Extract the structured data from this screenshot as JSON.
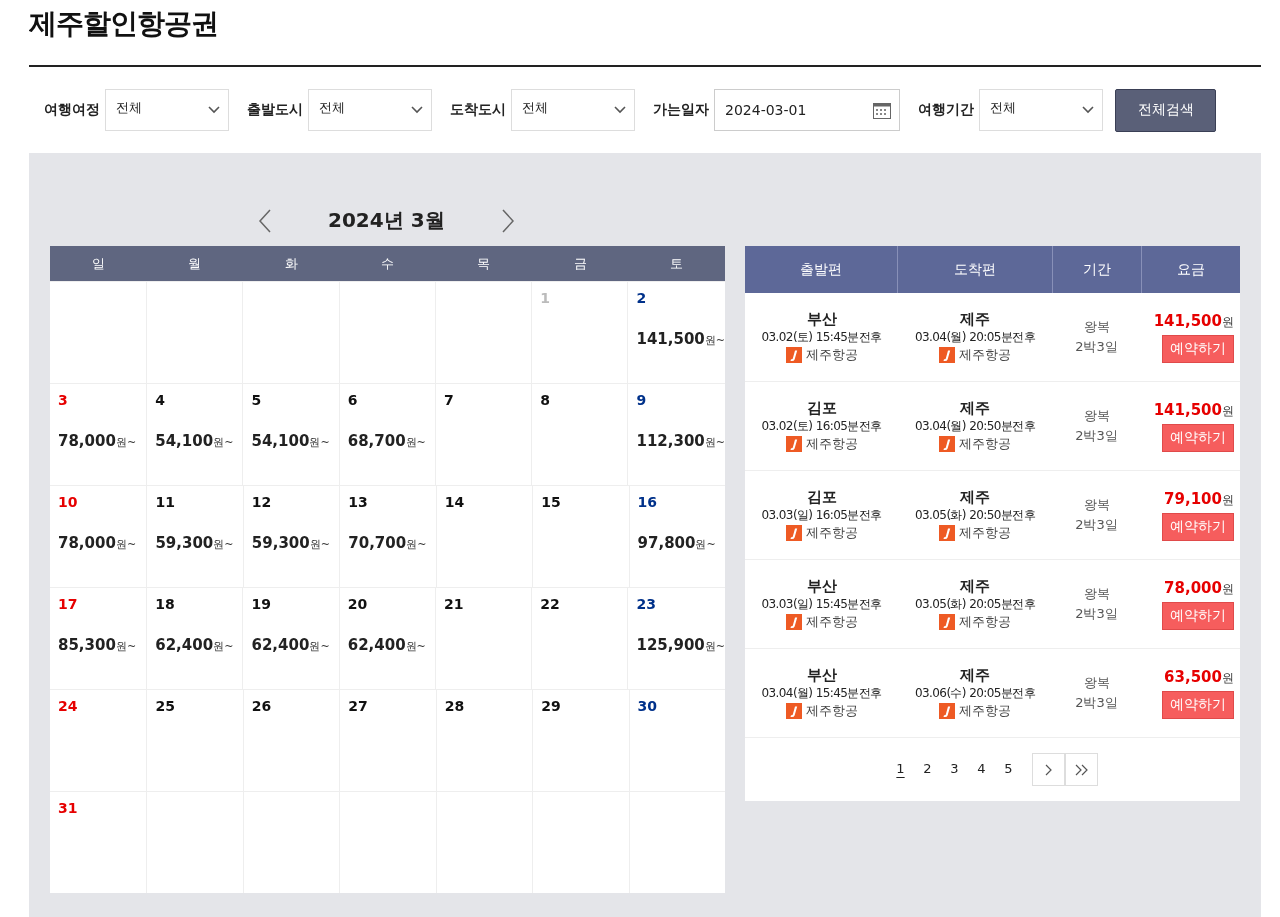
{
  "title": "제주할인항공권",
  "filters": [
    {
      "kind": "select",
      "label": "여행여정",
      "value": "전체"
    },
    {
      "kind": "select",
      "label": "출발도시",
      "value": "전체"
    },
    {
      "kind": "select",
      "label": "도착도시",
      "value": "전체"
    },
    {
      "kind": "date",
      "label": "가는일자",
      "value": "2024-03-01"
    },
    {
      "kind": "select",
      "label": "여행기간",
      "value": "전체"
    }
  ],
  "search_button": "전체검색",
  "calendar": {
    "month": "2024년 3월",
    "weekdays": [
      "일",
      "월",
      "화",
      "수",
      "목",
      "금",
      "토"
    ],
    "weeks": [
      [
        {
          "kind": "blank"
        },
        {
          "kind": "blank"
        },
        {
          "kind": "blank"
        },
        {
          "kind": "blank"
        },
        {
          "kind": "blank"
        },
        {
          "kind": "day",
          "day": "1",
          "disabled": true
        },
        {
          "kind": "day",
          "day": "2",
          "disabled": false,
          "price": "141,500",
          "unit": "원~"
        }
      ],
      [
        {
          "kind": "day",
          "day": "3",
          "disabled": false,
          "price": "78,000",
          "unit": "원~"
        },
        {
          "kind": "day",
          "day": "4",
          "disabled": false,
          "price": "54,100",
          "unit": "원~"
        },
        {
          "kind": "day",
          "day": "5",
          "disabled": false,
          "price": "54,100",
          "unit": "원~"
        },
        {
          "kind": "day",
          "day": "6",
          "disabled": false,
          "price": "68,700",
          "unit": "원~"
        },
        {
          "kind": "day",
          "day": "7",
          "disabled": false
        },
        {
          "kind": "day",
          "day": "8",
          "disabled": false
        },
        {
          "kind": "day",
          "day": "9",
          "disabled": false,
          "price": "112,300",
          "unit": "원~"
        }
      ],
      [
        {
          "kind": "day",
          "day": "10",
          "disabled": false,
          "price": "78,000",
          "unit": "원~"
        },
        {
          "kind": "day",
          "day": "11",
          "disabled": false,
          "price": "59,300",
          "unit": "원~"
        },
        {
          "kind": "day",
          "day": "12",
          "disabled": false,
          "price": "59,300",
          "unit": "원~"
        },
        {
          "kind": "day",
          "day": "13",
          "disabled": false,
          "price": "70,700",
          "unit": "원~"
        },
        {
          "kind": "day",
          "day": "14",
          "disabled": false
        },
        {
          "kind": "day",
          "day": "15",
          "disabled": false
        },
        {
          "kind": "day",
          "day": "16",
          "disabled": false,
          "price": "97,800",
          "unit": "원~"
        }
      ],
      [
        {
          "kind": "day",
          "day": "17",
          "disabled": false,
          "price": "85,300",
          "unit": "원~"
        },
        {
          "kind": "day",
          "day": "18",
          "disabled": false,
          "price": "62,400",
          "unit": "원~"
        },
        {
          "kind": "day",
          "day": "19",
          "disabled": false,
          "price": "62,400",
          "unit": "원~"
        },
        {
          "kind": "day",
          "day": "20",
          "disabled": false,
          "price": "62,400",
          "unit": "원~"
        },
        {
          "kind": "day",
          "day": "21",
          "disabled": false
        },
        {
          "kind": "day",
          "day": "22",
          "disabled": false
        },
        {
          "kind": "day",
          "day": "23",
          "disabled": false,
          "price": "125,900",
          "unit": "원~"
        }
      ],
      [
        {
          "kind": "day",
          "day": "24",
          "disabled": false
        },
        {
          "kind": "day",
          "day": "25",
          "disabled": false
        },
        {
          "kind": "day",
          "day": "26",
          "disabled": false
        },
        {
          "kind": "day",
          "day": "27",
          "disabled": false
        },
        {
          "kind": "day",
          "day": "28",
          "disabled": false
        },
        {
          "kind": "day",
          "day": "29",
          "disabled": false
        },
        {
          "kind": "day",
          "day": "30",
          "disabled": false
        }
      ],
      [
        {
          "kind": "day",
          "day": "31",
          "disabled": false
        },
        {
          "kind": "blank"
        },
        {
          "kind": "blank"
        },
        {
          "kind": "blank"
        },
        {
          "kind": "blank"
        },
        {
          "kind": "blank"
        },
        {
          "kind": "blank"
        }
      ]
    ]
  },
  "results": {
    "columns": [
      "출발편",
      "도착편",
      "기간",
      "요금"
    ],
    "rows": [
      {
        "dep_city": "부산",
        "dep_time": "03.02(토) 15:45분전후",
        "dep_airline": "제주항공",
        "arr_city": "제주",
        "arr_time": "03.04(월) 20:05분전후",
        "arr_airline": "제주항공",
        "trip": "왕복",
        "duration": "2박3일",
        "fare": "141,500",
        "unit": "원",
        "button": "예약하기"
      },
      {
        "dep_city": "김포",
        "dep_time": "03.02(토) 16:05분전후",
        "dep_airline": "제주항공",
        "arr_city": "제주",
        "arr_time": "03.04(월) 20:50분전후",
        "arr_airline": "제주항공",
        "trip": "왕복",
        "duration": "2박3일",
        "fare": "141,500",
        "unit": "원",
        "button": "예약하기"
      },
      {
        "dep_city": "김포",
        "dep_time": "03.03(일) 16:05분전후",
        "dep_airline": "제주항공",
        "arr_city": "제주",
        "arr_time": "03.05(화) 20:50분전후",
        "arr_airline": "제주항공",
        "trip": "왕복",
        "duration": "2박3일",
        "fare": "79,100",
        "unit": "원",
        "button": "예약하기"
      },
      {
        "dep_city": "부산",
        "dep_time": "03.03(일) 15:45분전후",
        "dep_airline": "제주항공",
        "arr_city": "제주",
        "arr_time": "03.05(화) 20:05분전후",
        "arr_airline": "제주항공",
        "trip": "왕복",
        "duration": "2박3일",
        "fare": "78,000",
        "unit": "원",
        "button": "예약하기"
      },
      {
        "dep_city": "부산",
        "dep_time": "03.04(월) 15:45분전후",
        "dep_airline": "제주항공",
        "arr_city": "제주",
        "arr_time": "03.06(수) 20:05분전후",
        "arr_airline": "제주항공",
        "trip": "왕복",
        "duration": "2박3일",
        "fare": "63,500",
        "unit": "원",
        "button": "예약하기"
      }
    ],
    "pages": [
      {
        "label": "1",
        "selected": true
      },
      {
        "label": "2",
        "selected": false
      },
      {
        "label": "3",
        "selected": false
      },
      {
        "label": "4",
        "selected": false
      },
      {
        "label": "5",
        "selected": false
      }
    ]
  }
}
